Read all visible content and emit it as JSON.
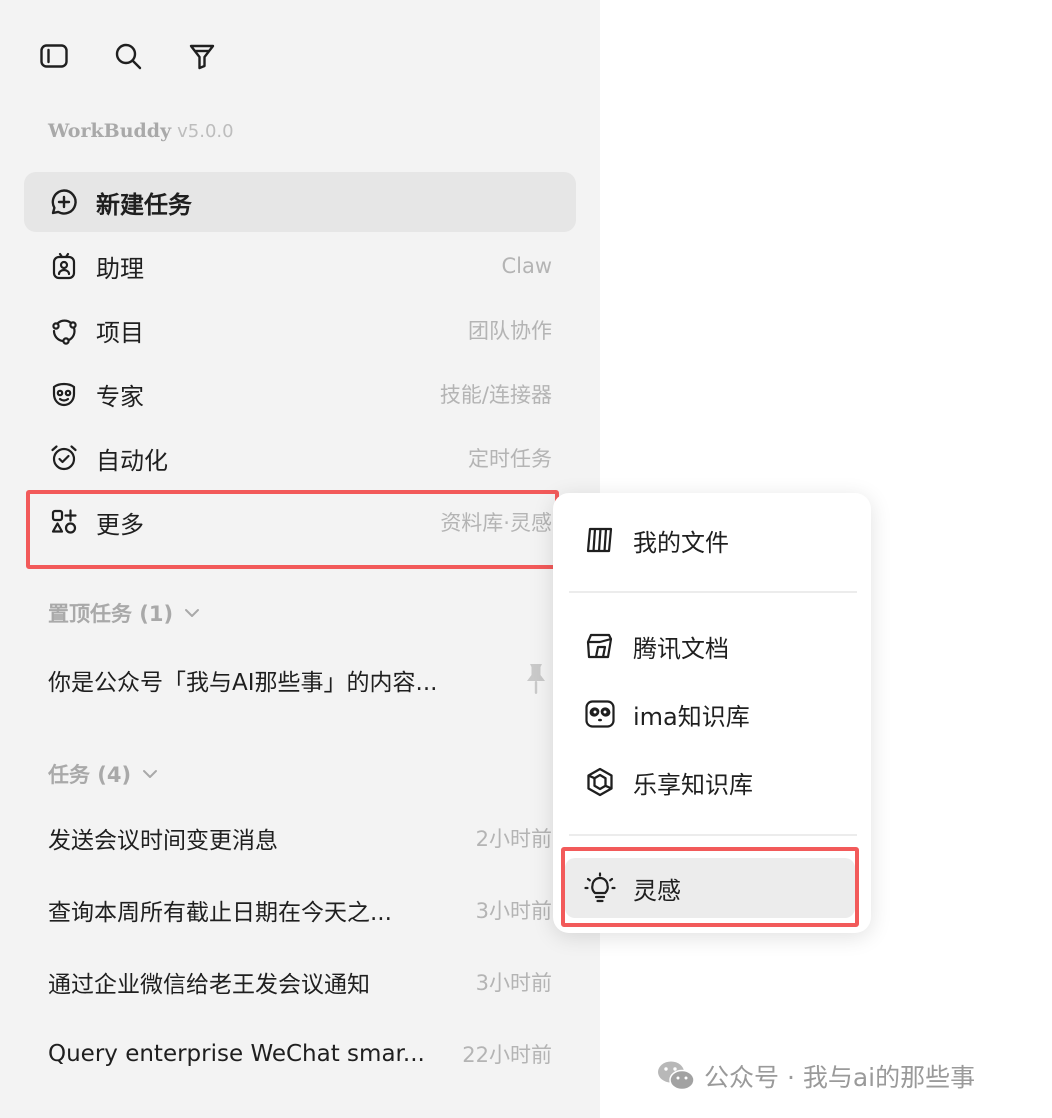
{
  "brand": {
    "name": "WorkBuddy",
    "version": "v5.0.0"
  },
  "nav": [
    {
      "label": "新建任务",
      "hint": "",
      "icon": "chat-plus-icon"
    },
    {
      "label": "助理",
      "hint": "Claw",
      "icon": "assistant-icon"
    },
    {
      "label": "项目",
      "hint": "团队协作",
      "icon": "project-icon"
    },
    {
      "label": "专家",
      "hint": "技能/连接器",
      "icon": "expert-icon"
    },
    {
      "label": "自动化",
      "hint": "定时任务",
      "icon": "alarm-clock-icon"
    },
    {
      "label": "更多",
      "hint": "资料库·灵感",
      "icon": "apps-plus-icon"
    }
  ],
  "pinned": {
    "title": "置顶任务 (1)",
    "items": [
      {
        "title": "你是公众号「我与AI那些事」的内容..."
      }
    ]
  },
  "tasks": {
    "title": "任务 (4)",
    "items": [
      {
        "title": "发送会议时间变更消息",
        "time": "2小时前"
      },
      {
        "title": "查询本周所有截止日期在今天之...",
        "time": "3小时前"
      },
      {
        "title": "通过企业微信给老王发会议通知",
        "time": "3小时前"
      },
      {
        "title": "Query enterprise WeChat smar...",
        "time": "22小时前"
      }
    ]
  },
  "popup": {
    "items": [
      {
        "label": "我的文件",
        "icon": "file-cabinet-icon"
      },
      {
        "label": "腾讯文档",
        "icon": "tencent-docs-icon"
      },
      {
        "label": "ima知识库",
        "icon": "panda-icon"
      },
      {
        "label": "乐享知识库",
        "icon": "hexagon-icon"
      },
      {
        "label": "灵感",
        "icon": "lightbulb-icon"
      }
    ]
  },
  "watermark": {
    "text": "公众号 · 我与ai的那些事"
  },
  "colors": {
    "highlight": "#f25a5a",
    "sidebar_bg": "#f3f3f3",
    "muted": "#b4b4b4"
  }
}
